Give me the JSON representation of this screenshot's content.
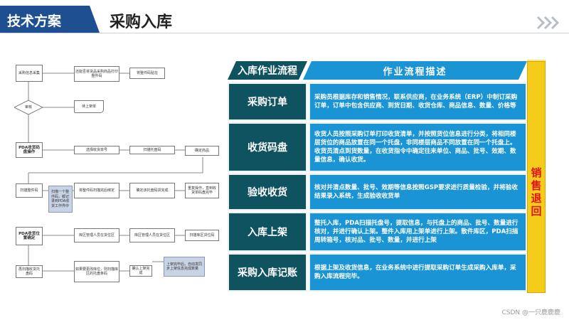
{
  "header": {
    "section_tag": "技术方案",
    "title": "采购入库"
  },
  "flowchart": {
    "nodes": {
      "n1": "采购信息采集",
      "n2": "还能否将货品采购商品打印整件码",
      "n3": "将整件码贴在",
      "n4": "审核",
      "n5": "待上架单",
      "n6": "PDA收货码盘操作",
      "n7": "选择收货单号",
      "n8": "扫描托盘码",
      "n9": "确定商品",
      "n10": "扫描整件码",
      "n11": "将整件码扫描完后绑定",
      "n12": "确定该托盘码货完成",
      "n13": "重复操作，直到收货单码盘完毕",
      "n14": "扫描一个整件码，都记录到PDA收货工作界中",
      "n15": "PDA收货位置确定",
      "n16": "库区管理人员在货位区",
      "n17": "库区管理人员在货位区",
      "n18": "扫描库区货位码",
      "n19": "再扫描收货托盘码",
      "n20": "如果要更改库位，则扫描库区的托盘条码",
      "n21": "确认上架完成",
      "n22": "上架完毕后，自动发同步上架信息完成数量"
    }
  },
  "table": {
    "header_left": "入库作业流程",
    "header_right": "作业流程描述",
    "side_label": "销售退回",
    "rows": [
      {
        "label": "采购订单",
        "desc": "采购员根据库存和销售情况，联系供应商，在业务系统（ERP）中制订采购订单，订单中包含供应商、到货日期、收货仓库、商品信息、数量、价格等"
      },
      {
        "label": "收货码盘",
        "desc": "收货人员按照采购订单打印收货清单，并按照货位信息进行分类，将相同楼层货位的商品放置在同一个托盘，非同楼层商品不同放置在同一个托盘上。收货员清点到货数量，在收货指令中确定往来单位、商品、批号、效期、数量信息，确认收货。"
      },
      {
        "label": "验收收货",
        "desc": "核对并清点数量、批号、效期等信息按照GSP要求进行质量检验，并将验收结果录入系统，生成验收收货单"
      },
      {
        "label": "入库上架",
        "desc": "整托入库，PDA扫描托盘号，提取信息，与托盘上的商品、批号、数量进行核对，并进行确认上架。整件入库用上架单进行上架。散件库区，PDA扫描周转箱号，核对品、批号、数量，并进行上架"
      },
      {
        "label": "采购入库记账",
        "desc": "根据上架及收货信息，在业务系统中进行提取采购订单生成采购入库单，采购入库流程完毕。"
      }
    ]
  },
  "watermark": "CSDN @一只鹿鹿鹿",
  "colors": {
    "header_tag": "#1d4f91",
    "row_label": "#0f5360",
    "row_desc": "#1a94d4",
    "side_bar": "#f5cc1a",
    "side_text": "#e3111b"
  }
}
